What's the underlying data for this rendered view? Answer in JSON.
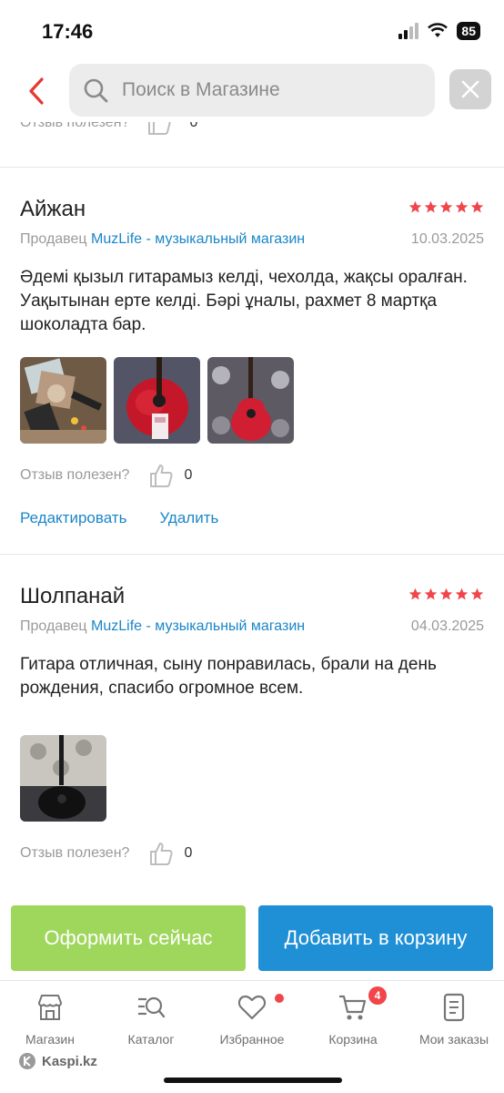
{
  "status_bar": {
    "time": "17:46",
    "battery": "85"
  },
  "search": {
    "placeholder": "Поиск в Магазине"
  },
  "partial_review": {
    "helpful_label": "Отзыв полезен?",
    "helpful_count": "0"
  },
  "reviews": [
    {
      "author": "Айжан",
      "rating": 5,
      "seller_prefix": "Продавец",
      "seller_name": "MuzLife - музыкальный магазин",
      "date": "10.03.2025",
      "text": "Әдемі қызыл гитарамыз келді, чехолда, жақсы оралған. Уақытынан ерте келді. Бәрі ұналы, рахмет 8 мартқа шоколадта бар.",
      "photos": [
        "package-photo",
        "red-guitar-photo",
        "red-guitar-on-carpet-photo"
      ],
      "helpful_label": "Отзыв полезен?",
      "helpful_count": "0",
      "edit_label": "Редактировать",
      "delete_label": "Удалить"
    },
    {
      "author": "Шолпанай",
      "rating": 5,
      "seller_prefix": "Продавец",
      "seller_name": "MuzLife - музыкальный магазин",
      "date": "04.03.2025",
      "text": "Гитара отличная, сыну понравилась, брали на день рождения, спасибо огромное всем.",
      "photos": [
        "black-guitar-photo"
      ],
      "helpful_label": "Отзыв полезен?",
      "helpful_count": "0"
    }
  ],
  "cta": {
    "buy_now": "Оформить сейчас",
    "add_to_cart": "Добавить в корзину"
  },
  "tabbar": {
    "items": [
      {
        "label": "Магазин",
        "icon": "store-icon"
      },
      {
        "label": "Каталог",
        "icon": "catalog-search-icon"
      },
      {
        "label": "Избранное",
        "icon": "heart-icon"
      },
      {
        "label": "Корзина",
        "icon": "cart-icon",
        "badge": "4"
      },
      {
        "label": "Мои заказы",
        "icon": "orders-icon"
      }
    ],
    "brand": "Kaspi.kz"
  },
  "colors": {
    "accent_blue": "#1f8fd6",
    "link_blue": "#1a86c8",
    "green": "#9fd65c",
    "star_red": "#f0464b",
    "back_red": "#e53935"
  }
}
